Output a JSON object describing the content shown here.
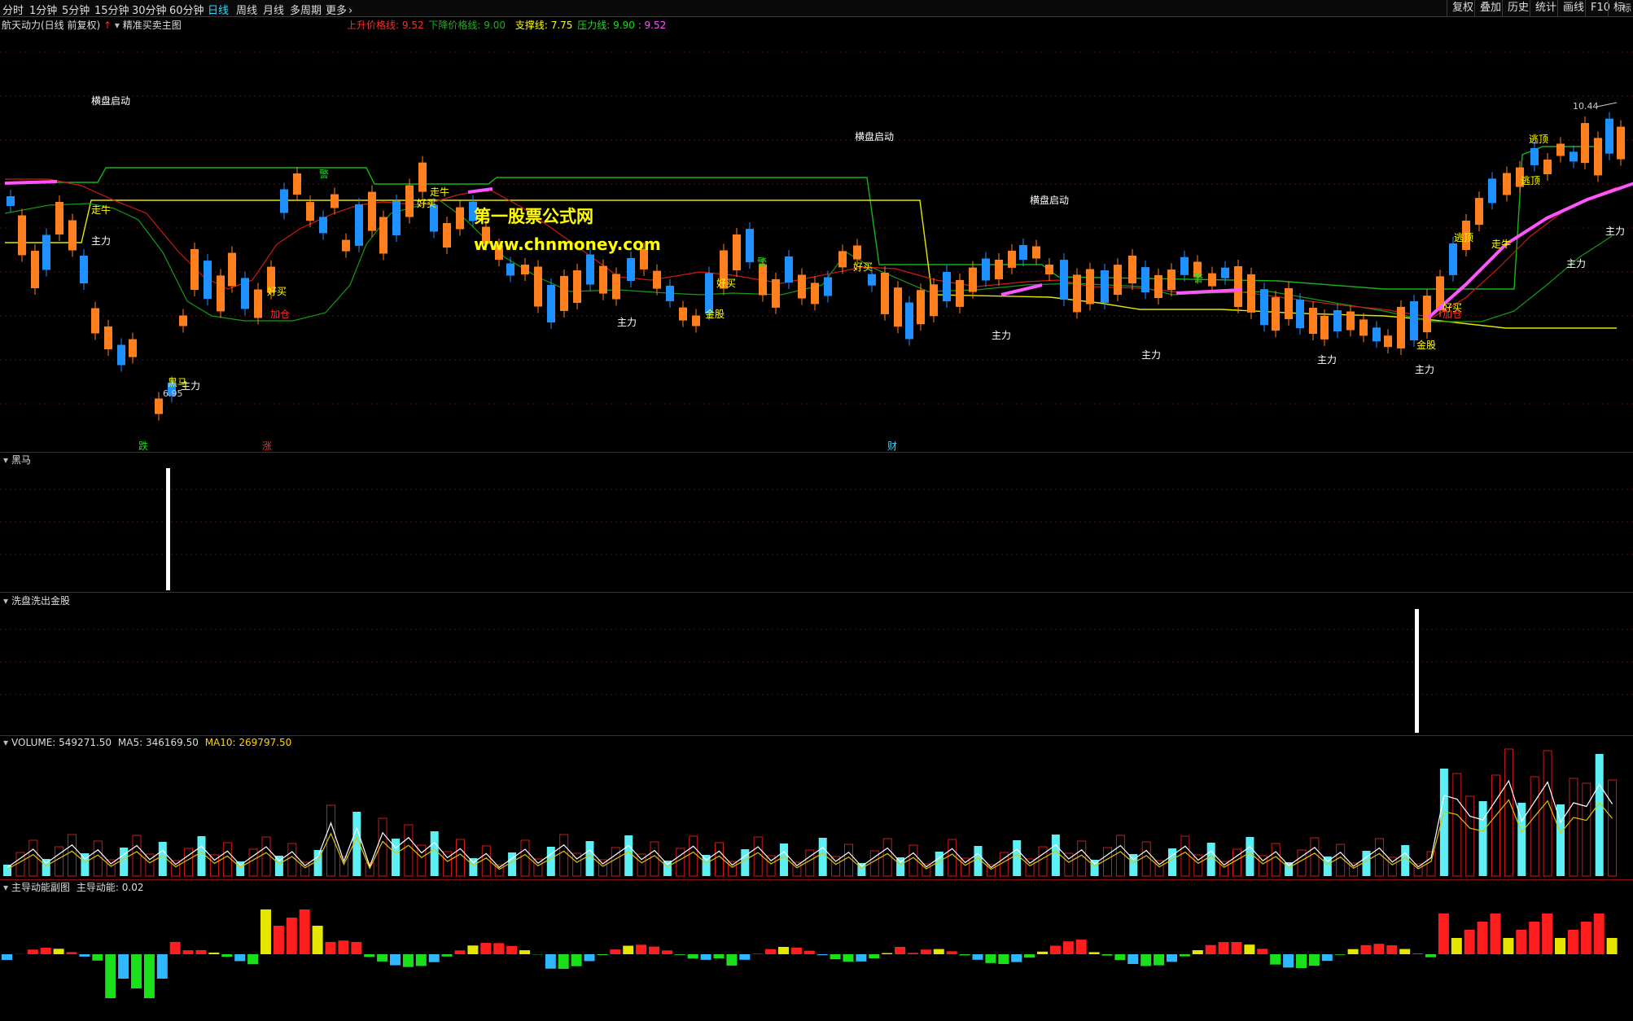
{
  "toolbar": {
    "periods": [
      "分时",
      "1分钟",
      "5分钟",
      "15分钟",
      "30分钟",
      "60分钟",
      "日线",
      "周线",
      "月线",
      "多周期",
      "更多"
    ],
    "active_period": "日线",
    "more_icon": "chevron-right-icon",
    "right_buttons": [
      "复权",
      "叠加",
      "历史",
      "统计",
      "画线",
      "F10",
      "标"
    ]
  },
  "main_header": {
    "stock": "航天动力(日线 前复权)",
    "up_arrow_icon": "red-up-arrow-icon",
    "indicator": "精准买卖主图",
    "up_line_label": "上升价格线:",
    "up_line_value": "9.52",
    "down_line_label": "下降价格线:",
    "down_line_value": "9.00",
    "support_label": "支撑线:",
    "support_value": "7.75",
    "pressure_label": "压力线:",
    "pressure_value": "9.90",
    "extra_value": ": 9.52",
    "colors": {
      "up": "#ff2a2a",
      "down": "#19b319",
      "support": "#ffff00",
      "pressure": "#19e019",
      "extra": "#ff55ff"
    }
  },
  "main_chart": {
    "price_high_label": "10.44",
    "price_low_label": "6.95",
    "right_edge_label": "标",
    "watermark_line1": "第一股票公式网",
    "watermark_line2": "www.chnmoney.com",
    "chart_labels": {
      "hengpan": "横盘启动",
      "zhuli": "主力",
      "zouniu": "走牛",
      "haomai": "好买",
      "jiacang": "加仓",
      "jingu": "金股",
      "taoding": "逃顶",
      "heima": "黑马",
      "jing": "警",
      "die": "跌",
      "zhang": "涨",
      "cai": "财"
    }
  },
  "panels": {
    "heima": {
      "title": "黑马"
    },
    "xipan": {
      "title": "洗盘洗出金股"
    },
    "volume": {
      "label": "VOLUME:",
      "value": "549271.50",
      "ma5_label": "MA5:",
      "ma5_value": "346169.50",
      "ma10_label": "MA10:",
      "ma10_value": "269797.50"
    },
    "energy": {
      "title": "主导动能副图",
      "label": "主导动能:",
      "value": "0.02"
    }
  }
}
